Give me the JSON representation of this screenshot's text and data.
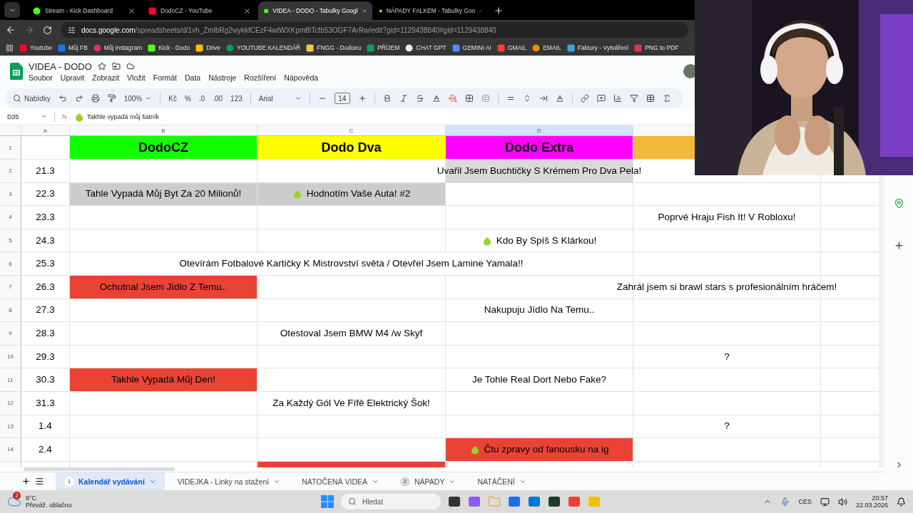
{
  "browser": {
    "tabs": [
      {
        "title": "Stream - Kick Dashboard",
        "selected": false
      },
      {
        "title": "DodoCZ - YouTube",
        "selected": false
      },
      {
        "title": "VIDEA - DODO - Tabulky Googl",
        "selected": true
      },
      {
        "title": "NÁPADY FALKEM - Tabulky Goo",
        "selected": false
      }
    ],
    "url_domain": "docs.google.com",
    "url_path": "/spreadsheets/d/1vh_ZmlbRg2wykkfCEzF4wtWXKpm8ITcfb53OGF7ArRw/edit?gid=1129438840#gid=1129438840",
    "bookmarks": [
      "Youtube",
      "Můj FB",
      "Můj instagram",
      "Kick - Dodo",
      "Drive",
      "YOUTUBE KALENDÁŘ",
      "FNGG - Dodoeu",
      "PŘÍJEM",
      "CHAT GPT",
      "GEMINI AI",
      "GMAIL",
      "EMAIL",
      "Faktury - Vytváření",
      "PNG to PDF"
    ]
  },
  "document": {
    "title": "VIDEA - DODO",
    "menu": [
      "Soubor",
      "Upravit",
      "Zobrazit",
      "Vložit",
      "Formát",
      "Data",
      "Nástroje",
      "Rozšíření",
      "Nápověda"
    ]
  },
  "toolbar": {
    "search": "Nabídky",
    "zoom": "100%",
    "currency": "Kč",
    "percent": "%",
    "decrease_decimals": ".0",
    "increase_decimals": ".00",
    "number_format": "123",
    "font": "Arial",
    "font_size": "14"
  },
  "formula_bar": {
    "cell_ref": "D35",
    "fx_label": "fx",
    "content": "Takhle vypadá můj šatník"
  },
  "grid": {
    "columns": [
      {
        "label": "A",
        "selected": false
      },
      {
        "label": "B",
        "selected": false
      },
      {
        "label": "C",
        "selected": false
      },
      {
        "label": "D",
        "selected": true
      }
    ],
    "rows": [
      {
        "number": "1",
        "header": true,
        "cells": {
          "B": {
            "text": "DodoCZ",
            "color": "#11ff00"
          },
          "C": {
            "text": "Dodo Dva",
            "color": "#ffff00"
          },
          "D": {
            "text": "Dodo Extra",
            "color": "#ff00ff"
          },
          "E": {
            "color": "#f1b83a"
          }
        }
      },
      {
        "number": "2",
        "cells": {
          "A": {
            "text": "21.3"
          },
          "D": {
            "text": "Uvařil Jsem Buchtičky S Krémem Pro Dva Pela!",
            "color": "#d9d9d9"
          }
        }
      },
      {
        "number": "3",
        "cells": {
          "A": {
            "text": "22.3"
          },
          "B": {
            "text": "Tahle Vypadá Můj Byt Za 20 Milionů!",
            "color": "#cccccc"
          },
          "C": {
            "text": "Hodnotím Vaše Auta! #2",
            "color": "#cccccc",
            "kind": "emoji"
          }
        }
      },
      {
        "number": "4",
        "cells": {
          "A": {
            "text": "23.3"
          },
          "E": {
            "text": "Poprvé Hraju Fish It! V Robloxu!"
          }
        }
      },
      {
        "number": "5",
        "cells": {
          "A": {
            "text": "24.3"
          },
          "D": {
            "text": "Kdo By Spíš S Klárkou!",
            "kind": "emoji"
          }
        }
      },
      {
        "number": "6",
        "cells": {
          "A": {
            "text": "25.3"
          },
          "B": {
            "text": "Otevírám Fotbalové Kartičky K Mistrovství světa / Otevřel Jsem Lamine Yamala!!",
            "merged": true
          }
        }
      },
      {
        "number": "7",
        "cells": {
          "A": {
            "text": "26.3"
          },
          "B": {
            "text": "Ochutnal Jsem Jídlo Z Temu..",
            "color": "#ea4335"
          },
          "E": {
            "text": "Zahrál jsem si brawl stars s profesionálním hráčem!"
          }
        }
      },
      {
        "number": "8",
        "cells": {
          "A": {
            "text": "27.3"
          },
          "D": {
            "text": "Nakupuju Jídlo Na Temu.."
          }
        }
      },
      {
        "number": "9",
        "cells": {
          "A": {
            "text": "28.3"
          },
          "C": {
            "text": "Otestoval Jsem BMW M4 /w Skyf"
          }
        }
      },
      {
        "number": "10",
        "cells": {
          "A": {
            "text": "29.3"
          },
          "E": {
            "text": "?"
          }
        }
      },
      {
        "number": "11",
        "cells": {
          "A": {
            "text": "30.3"
          },
          "B": {
            "text": "Takhle Vypadá Můj Den!",
            "color": "#ea4335"
          },
          "D": {
            "text": "Je Tohle Real Dort Nebo Fake?"
          }
        }
      },
      {
        "number": "12",
        "cells": {
          "A": {
            "text": "31.3"
          },
          "C": {
            "text": "Za Každý Gól Ve Fífě Elektrický Šok!"
          }
        }
      },
      {
        "number": "13",
        "cells": {
          "A": {
            "text": "1.4"
          },
          "E": {
            "text": "?"
          }
        }
      },
      {
        "number": "14",
        "cells": {
          "A": {
            "text": "2.4"
          },
          "D": {
            "text": "Čtu zpravy od fanousku na ig",
            "color": "#ea4335",
            "kind": "emoji"
          }
        }
      },
      {
        "cells": {
          "C": {
            "color": "#ea4335"
          }
        }
      }
    ]
  },
  "sheet_tabs": [
    {
      "label": "Kalendář vydávání",
      "badge": "1",
      "selected": true
    },
    {
      "label": "VIDEJKA - Linky na stažení",
      "selected": false
    },
    {
      "label": "NATOČENÁ VIDEA",
      "selected": false
    },
    {
      "label": "NÁPADY",
      "badge": "2",
      "selected": false
    },
    {
      "label": "NATÁČENÍ",
      "selected": false
    }
  ],
  "taskbar": {
    "weather_badge": "2",
    "temperature": "8°C",
    "weather": "Převáž. oblačno",
    "search": "Hledat",
    "language": "CES",
    "time": "20:57",
    "date": "22.03.2026"
  }
}
